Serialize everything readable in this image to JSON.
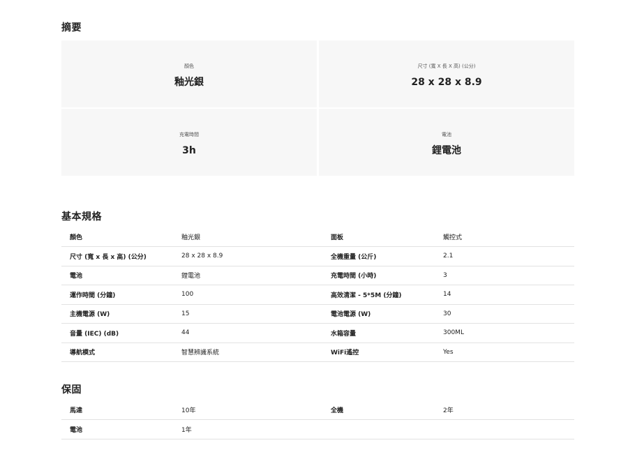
{
  "summary": {
    "title": "摘要",
    "items": [
      {
        "label": "顏色",
        "value": "釉光銀"
      },
      {
        "label": "尺寸 (寬 X 長 X 高) (公分)",
        "value": "28 x 28 x 8.9"
      },
      {
        "label": "充電時間",
        "value": "3h"
      },
      {
        "label": "電池",
        "value": "鋰電池"
      }
    ]
  },
  "basic_specs": {
    "title": "基本規格",
    "rows": [
      [
        "顏色",
        "釉光銀",
        "面板",
        "觸控式"
      ],
      [
        "尺寸 (寬 x 長 x 高) (公分)",
        "28 x 28 x 8.9",
        "全機重量 (公斤)",
        "2.1"
      ],
      [
        "電池",
        "鋰電池",
        "充電時間 (小時)",
        "3"
      ],
      [
        "運作時間 (分鐘)",
        "100",
        "高效清潔 - 5*5M (分鐘)",
        "14"
      ],
      [
        "主機電源 (W)",
        "15",
        "電池電源 (W)",
        "30"
      ],
      [
        "音量 (IEC) (dB)",
        "44",
        "水箱容量",
        "300ML"
      ],
      [
        "導航模式",
        "智慧辨識系統",
        "WiFi遙控",
        "Yes"
      ]
    ]
  },
  "warranty": {
    "title": "保固",
    "rows": [
      [
        "馬達",
        "10年",
        "全機",
        "2年"
      ],
      [
        "電池",
        "1年",
        "",
        ""
      ]
    ]
  }
}
